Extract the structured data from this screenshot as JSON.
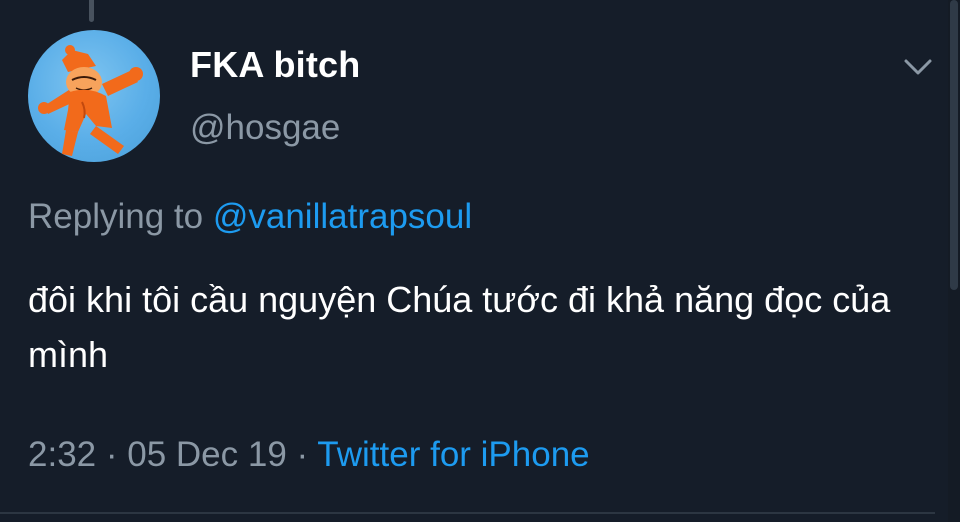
{
  "tweet": {
    "display_name": "FKA bitch",
    "handle": "@hosgae",
    "replying_prefix": "Replying to",
    "replying_to": "@vanillatrapsoul",
    "text": "đôi khi tôi cầu nguyện Chúa tước đi khả năng đọc của mình",
    "time": "2:32",
    "separator": "·",
    "date": "05 Dec 19",
    "source": "Twitter for iPhone"
  },
  "icons": {
    "avatar": "orange-cartoon-character-avatar",
    "menu": "chevron-down-icon"
  },
  "colors": {
    "background": "#151d29",
    "primary_text": "#ffffff",
    "secondary_text": "#8b98a5",
    "accent": "#1d9bf0",
    "avatar_bg": "#5aaee8",
    "avatar_figure": "#f26a1b"
  }
}
